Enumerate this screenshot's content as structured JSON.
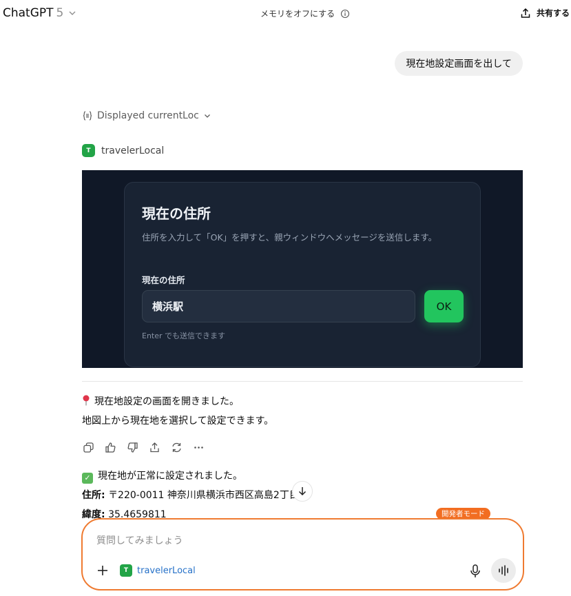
{
  "header": {
    "model_name": "ChatGPT",
    "model_version": "5",
    "memory_label": "メモリをオフにする",
    "share_label": "共有する"
  },
  "user_message": "現在地設定画面を出して",
  "tool_call": {
    "label": "Displayed currentLoc"
  },
  "app": {
    "name": "travelerLocal",
    "badge": "T"
  },
  "widget": {
    "title": "現在の住所",
    "description": "住所を入力して「OK」を押すと、親ウィンドウへメッセージを送信します。",
    "field_label": "現在の住所",
    "input_value": "横浜駅",
    "ok_label": "OK",
    "hint": "Enter でも送信できます"
  },
  "assistant": {
    "line1": "現在地設定の画面を開きました。",
    "line2": "地図上から現在地を選択して設定できます。",
    "confirm": "現在地が正常に設定されました。",
    "address_label": "住所:",
    "address_value": "〒220-0011 神奈川県横浜市西区高島2丁目16",
    "lat_label": "緯度:",
    "lat_value": "35.4659811"
  },
  "dev_mode_label": "開発者モード",
  "composer": {
    "placeholder": "質問してみましょう",
    "tool_name": "travelerLocal",
    "tool_badge": "T"
  },
  "colors": {
    "accent_orange": "#ef7a30",
    "app_green": "#22a447",
    "ok_green": "#22c55e",
    "widget_bg": "#101827"
  }
}
